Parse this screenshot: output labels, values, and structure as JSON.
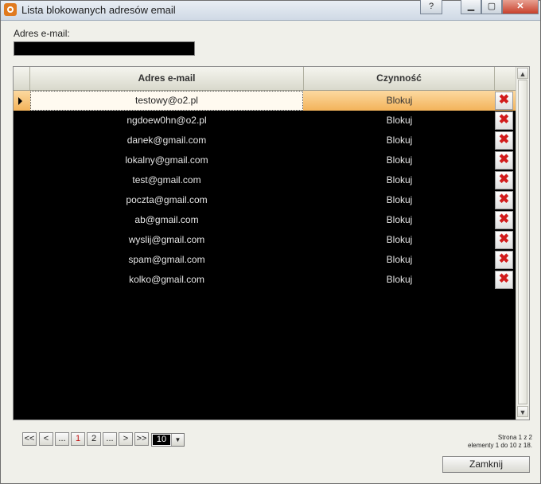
{
  "window": {
    "title": "Lista blokowanych adresów email"
  },
  "title_buttons": {
    "help": "?",
    "close": "✕"
  },
  "filter": {
    "label": "Adres e-mail:",
    "value": ""
  },
  "grid": {
    "columns": [
      "Adres e-mail",
      "Czynność"
    ],
    "rows": [
      {
        "email": "testowy@o2.pl",
        "action": "Blokuj"
      },
      {
        "email": "ngdoew0hn@o2.pl",
        "action": "Blokuj"
      },
      {
        "email": "danek@gmail.com",
        "action": "Blokuj"
      },
      {
        "email": "lokalny@gmail.com",
        "action": "Blokuj"
      },
      {
        "email": "test@gmail.com",
        "action": "Blokuj"
      },
      {
        "email": "poczta@gmail.com",
        "action": "Blokuj"
      },
      {
        "email": "ab@gmail.com",
        "action": "Blokuj"
      },
      {
        "email": "wyslij@gmail.com",
        "action": "Blokuj"
      },
      {
        "email": "spam@gmail.com",
        "action": "Blokuj"
      },
      {
        "email": "kolko@gmail.com",
        "action": "Blokuj"
      }
    ],
    "delete_icon": "close-icon",
    "delete_color": "#d21c1c",
    "selected_row_color": "#f3b35a"
  },
  "pager": {
    "first": "<<",
    "prev": "<",
    "ellipsis_left": "...",
    "pages": [
      "1",
      "2"
    ],
    "ellipsis_right": "...",
    "next": ">",
    "last": ">>",
    "page_size": "10"
  },
  "page_info": {
    "line1": "Strona 1 z 2",
    "line2": "elementy 1 do 10 z 18."
  },
  "close_button": "Zamknij"
}
